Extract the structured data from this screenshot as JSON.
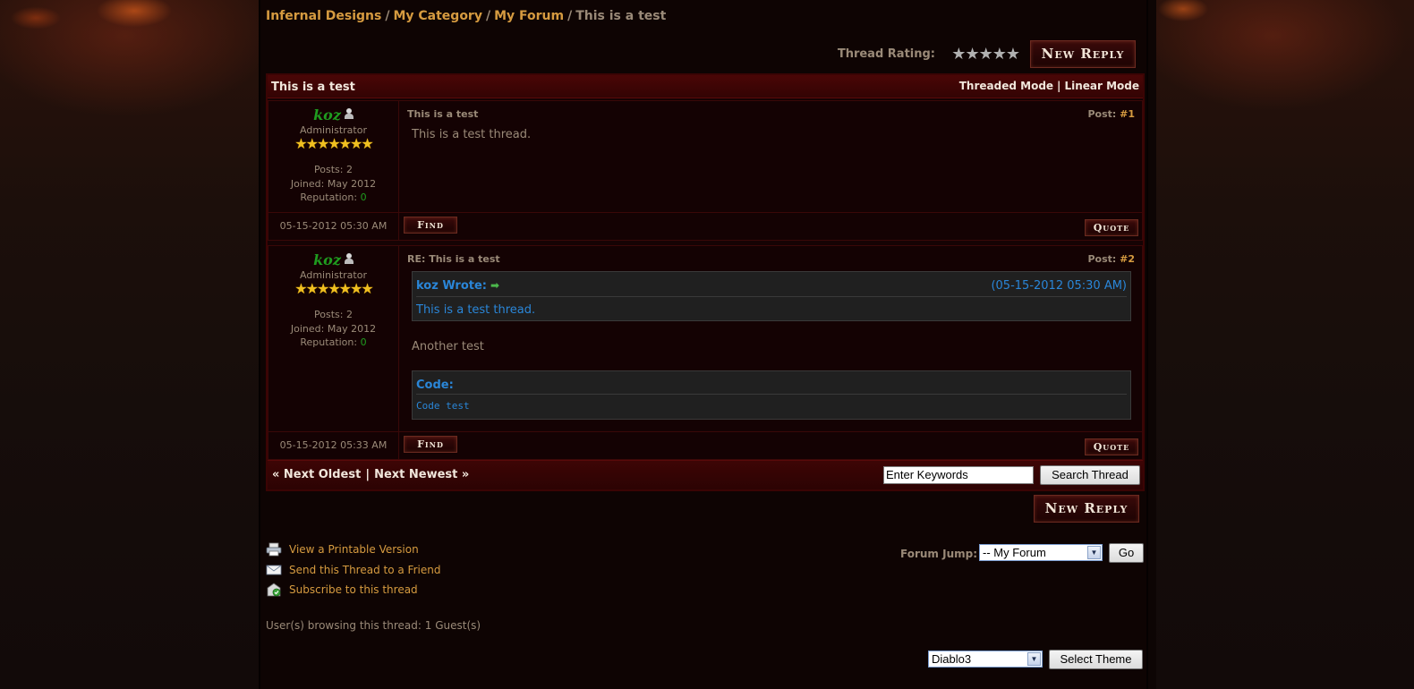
{
  "breadcrumb": {
    "items": [
      "Infernal Designs",
      "My Category",
      "My Forum"
    ],
    "current": "This is a test",
    "separator": "/"
  },
  "thread_rating": {
    "label": "Thread Rating:",
    "stars_total": 5,
    "stars_filled": 0
  },
  "buttons": {
    "new_reply": "New Reply",
    "find": "Find",
    "quote": "Quote",
    "search_thread": "Search Thread",
    "go": "Go",
    "select_theme": "Select Theme"
  },
  "thread": {
    "title": "This is a test",
    "modes": [
      "Threaded Mode",
      "Linear Mode"
    ],
    "mode_separator": "|"
  },
  "posts": [
    {
      "author": "koz",
      "role": "Administrator",
      "stars": "★★★★★★★",
      "posts_label": "Posts:",
      "posts": "2",
      "joined_label": "Joined:",
      "joined": "May 2012",
      "reputation_label": "Reputation:",
      "reputation": "0",
      "subject": "This is a test",
      "post_label": "Post:",
      "post_num": "#1",
      "body": "This is a test thread.",
      "date": "05-15-2012 05:30 AM"
    },
    {
      "author": "koz",
      "role": "Administrator",
      "stars": "★★★★★★★",
      "posts_label": "Posts:",
      "posts": "2",
      "joined_label": "Joined:",
      "joined": "May 2012",
      "reputation_label": "Reputation:",
      "reputation": "0",
      "subject": "RE: This is a test",
      "post_label": "Post:",
      "post_num": "#2",
      "quote": {
        "header": "koz Wrote:",
        "date": "(05-15-2012 05:30 AM)",
        "text": "This is a test thread."
      },
      "body": "Another test",
      "code": {
        "header": "Code:",
        "text": "Code test"
      },
      "date": "05-15-2012 05:33 AM"
    }
  ],
  "thread_nav": {
    "next_oldest": "« Next Oldest",
    "separator": "|",
    "next_newest": "Next Newest »"
  },
  "search": {
    "value": "Enter Keywords"
  },
  "tools": [
    {
      "icon": "printer-icon",
      "label": "View a Printable Version"
    },
    {
      "icon": "envelope-icon",
      "label": "Send this Thread to a Friend"
    },
    {
      "icon": "subscribe-icon",
      "label": "Subscribe to this thread"
    }
  ],
  "forum_jump": {
    "label": "Forum Jump:",
    "selected": "-- My Forum"
  },
  "browsing": "User(s) browsing this thread: 1 Guest(s)",
  "theme": {
    "selected": "Diablo3"
  },
  "colors": {
    "link": "#d69b40",
    "header_red": "#4a0606",
    "online_green": "#1f9c1f",
    "quote_blue": "#2a86d8",
    "star_gold": "#f0c020"
  }
}
